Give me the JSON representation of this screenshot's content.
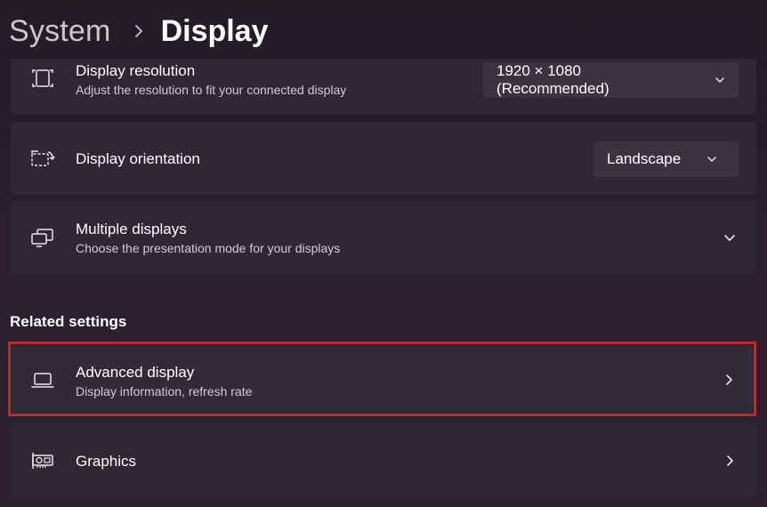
{
  "breadcrumb": {
    "parent": "System",
    "separator_icon": "chevron-right-icon",
    "current": "Display"
  },
  "settings": {
    "resolution": {
      "icon": "screen-resolution-icon",
      "title": "Display resolution",
      "subtitle": "Adjust the resolution to fit your connected display",
      "value": "1920 × 1080 (Recommended)"
    },
    "orientation": {
      "icon": "screen-rotate-icon",
      "title": "Display orientation",
      "value": "Landscape"
    },
    "multiple": {
      "icon": "multiple-displays-icon",
      "title": "Multiple displays",
      "subtitle": "Choose the presentation mode for your displays"
    }
  },
  "related": {
    "heading": "Related settings",
    "advanced": {
      "icon": "laptop-icon",
      "title": "Advanced display",
      "subtitle": "Display information, refresh rate"
    },
    "graphics": {
      "icon": "graphics-card-icon",
      "title": "Graphics"
    }
  },
  "colors": {
    "background": "#2a2030",
    "card": "#2f2834",
    "highlight": "#d4202d"
  }
}
